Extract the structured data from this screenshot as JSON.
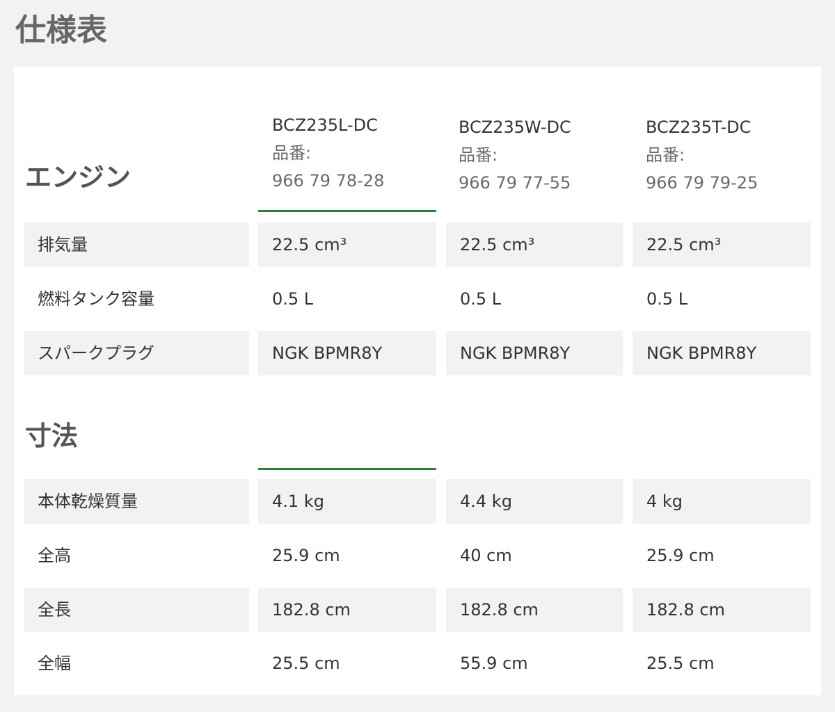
{
  "page_title": "仕様表",
  "products": [
    {
      "model": "BCZ235L-DC",
      "pn_label": "品番:",
      "pn_value": "966 79 78-28"
    },
    {
      "model": "BCZ235W-DC",
      "pn_label": "品番:",
      "pn_value": "966 79 77-55"
    },
    {
      "model": "BCZ235T-DC",
      "pn_label": "品番:",
      "pn_value": "966 79 79-25"
    }
  ],
  "sections": [
    {
      "title": "エンジン",
      "rows": [
        {
          "label": "排気量",
          "values": [
            "22.5 cm³",
            "22.5 cm³",
            "22.5 cm³"
          ]
        },
        {
          "label": "燃料タンク容量",
          "values": [
            "0.5 L",
            "0.5 L",
            "0.5 L"
          ]
        },
        {
          "label": "スパークプラグ",
          "values": [
            "NGK BPMR8Y",
            "NGK BPMR8Y",
            "NGK BPMR8Y"
          ]
        }
      ]
    },
    {
      "title": "寸法",
      "rows": [
        {
          "label": "本体乾燥質量",
          "values": [
            "4.1 kg",
            "4.4 kg",
            "4 kg"
          ]
        },
        {
          "label": "全高",
          "values": [
            "25.9 cm",
            "40 cm",
            "25.9 cm"
          ]
        },
        {
          "label": "全長",
          "values": [
            "182.8 cm",
            "182.8 cm",
            "182.8 cm"
          ]
        },
        {
          "label": "全幅",
          "values": [
            "25.5 cm",
            "55.9 cm",
            "25.5 cm"
          ]
        }
      ]
    }
  ],
  "colors": {
    "page_background": "#f2f2f0",
    "card_background": "#ffffff",
    "shaded_row": "#f2f2f2",
    "accent_rule": "#2e7d32",
    "title_text": "#666666"
  }
}
